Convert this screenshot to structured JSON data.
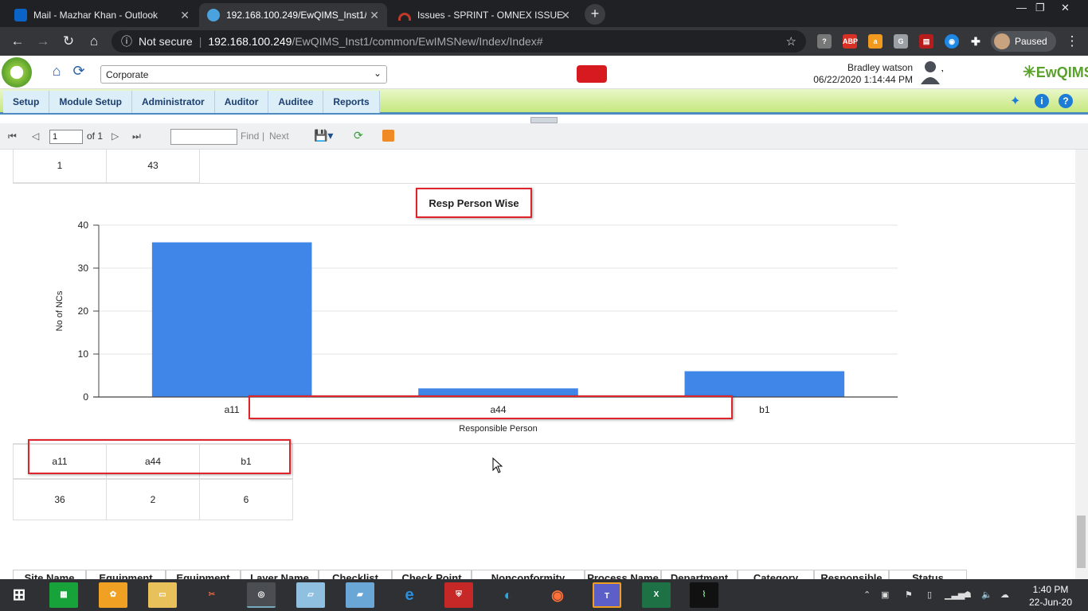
{
  "browser": {
    "tabs": [
      {
        "label": "Mail - Mazhar Khan - Outlook",
        "icon": "outlook-icon",
        "active": false
      },
      {
        "label": "192.168.100.249/EwQIMS_Inst1/c",
        "icon": "site-icon",
        "active": true
      },
      {
        "label": "Issues - SPRINT - OMNEX ISSUE",
        "icon": "issues-icon",
        "active": false
      }
    ],
    "new_tab": "+",
    "security": "Not secure",
    "url_host": "192.168.100.249",
    "url_path": "/EwQIMS_Inst1/common/EwIMSNew/Index/Index#",
    "profile_status": "Paused"
  },
  "app": {
    "site_select": "Corporate",
    "user_name": "Bradley watson",
    "datetime": "06/22/2020 1:14:44 PM",
    "brand": "EwQIMS",
    "menu": [
      "Setup",
      "Module Setup",
      "Administrator",
      "Auditor",
      "Auditee",
      "Reports"
    ]
  },
  "report_toolbar": {
    "page": "1",
    "of_label": "of 1",
    "find_label": "Find",
    "separator": "|",
    "next_label": "Next"
  },
  "top_table": {
    "cells": [
      "1",
      "43"
    ]
  },
  "chart_data": {
    "type": "bar",
    "title": "Resp Person Wise",
    "xlabel": "Responsible Person",
    "ylabel": "No of NCs",
    "categories": [
      "a11",
      "a44",
      "b1"
    ],
    "values": [
      36,
      2,
      6
    ],
    "ylim": [
      0,
      40
    ],
    "yticks": [
      0,
      10,
      20,
      30,
      40
    ],
    "grid": true,
    "bar_color": "#3f86e8"
  },
  "data_table": {
    "headers": [
      "a11",
      "a44",
      "b1"
    ],
    "values": [
      "36",
      "2",
      "6"
    ]
  },
  "grid_headers": [
    "Site Name",
    "Equipment Code",
    "Equipment Name",
    "Layer Name",
    "Checklist Name",
    "Check Point",
    "Nonconformity",
    "Process Name",
    "Department",
    "Category",
    "Responsible Person",
    "Status"
  ],
  "taskbar": {
    "time": "1:40 PM",
    "date": "22-Jun-20"
  }
}
